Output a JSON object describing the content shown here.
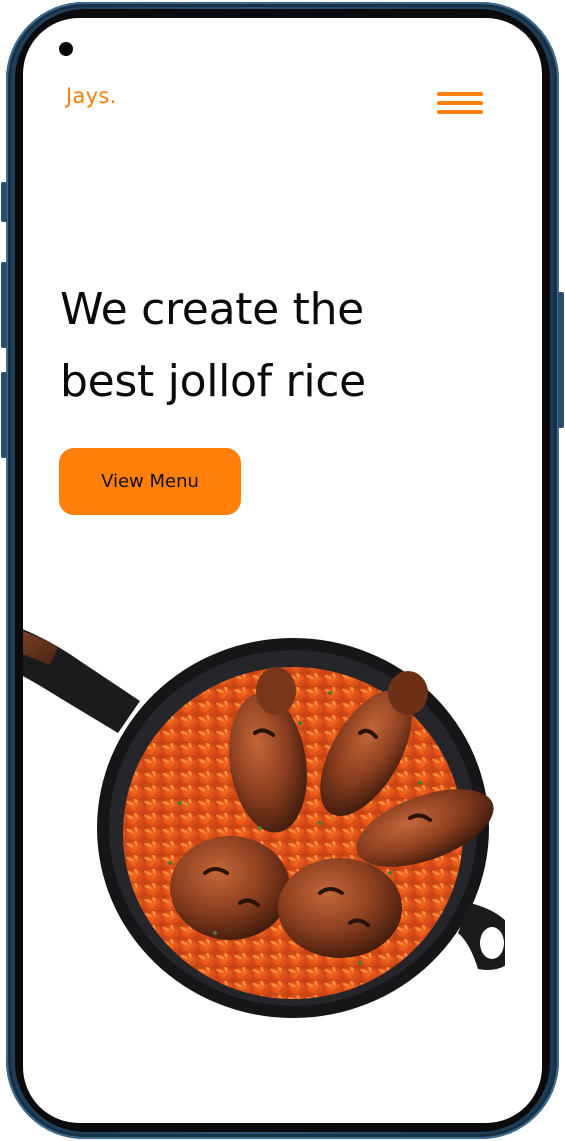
{
  "header": {
    "logo_text": "Jays.",
    "menu_icon": "hamburger-menu-icon"
  },
  "hero": {
    "title_line1": "We create the",
    "title_line2": "best jollof rice",
    "cta_label": "View Menu"
  },
  "image": {
    "subject": "jollof-rice-with-chicken-in-skillet"
  },
  "colors": {
    "accent": "#ff7f0a",
    "text": "#0a0a0a",
    "background": "#ffffff",
    "frame": "#2d5475"
  }
}
